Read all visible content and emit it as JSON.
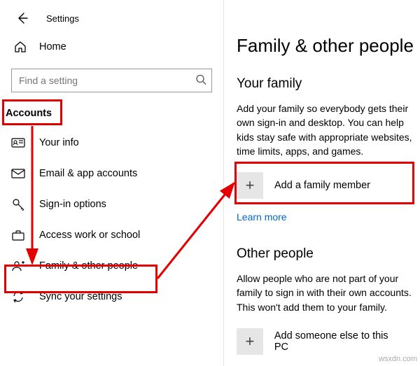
{
  "header": {
    "app_title": "Settings",
    "home_label": "Home"
  },
  "search": {
    "placeholder": "Find a setting"
  },
  "sidebar": {
    "heading": "Accounts",
    "items": [
      {
        "label": "Your info"
      },
      {
        "label": "Email & app accounts"
      },
      {
        "label": "Sign-in options"
      },
      {
        "label": "Access work or school"
      },
      {
        "label": "Family & other people"
      },
      {
        "label": "Sync your settings"
      }
    ]
  },
  "main": {
    "title": "Family & other people",
    "family_heading": "Your family",
    "family_desc": "Add your family so everybody gets their own sign-in and desktop. You can help kids stay safe with appropriate websites, time limits, apps, and games.",
    "add_family_label": "Add a family member",
    "learn_more": "Learn more",
    "other_heading": "Other people",
    "other_desc": "Allow people who are not part of your family to sign in with their own accounts. This won't add them to your family.",
    "add_other_label": "Add someone else to this PC"
  },
  "watermark": "wsxdn.com"
}
